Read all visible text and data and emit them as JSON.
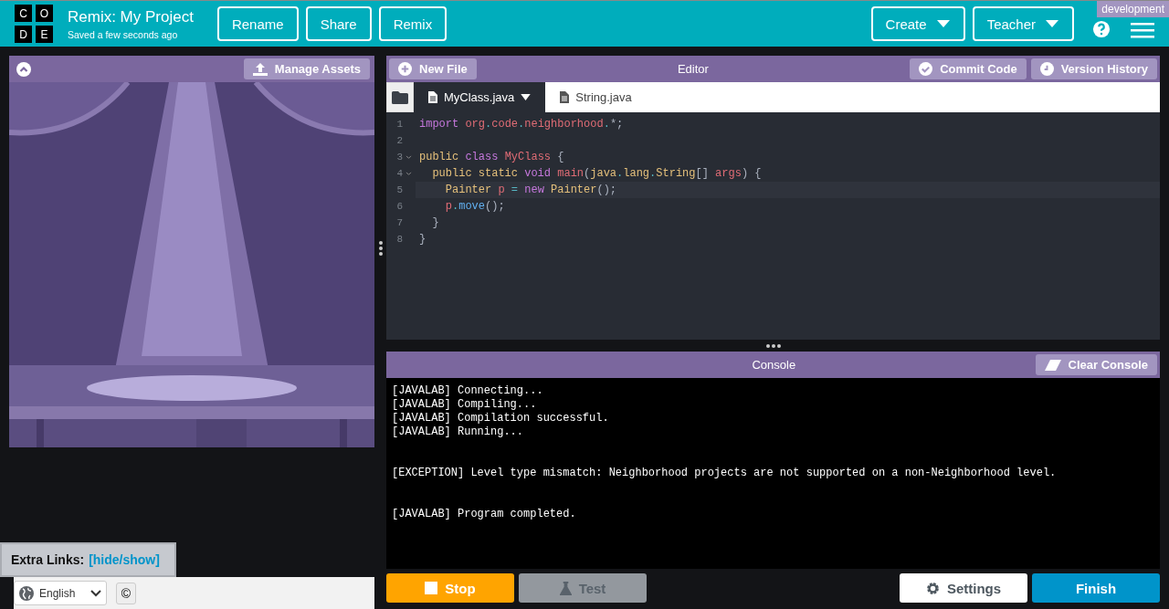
{
  "header": {
    "logo_letters": [
      "C",
      "O",
      "D",
      "E"
    ],
    "title": "Remix: My Project",
    "subtitle": "Saved a few seconds ago",
    "buttons": [
      "Rename",
      "Share",
      "Remix"
    ],
    "menus": [
      "Create",
      "Teacher"
    ],
    "badge": "development"
  },
  "preview": {
    "manage_assets": "Manage Assets"
  },
  "extra_links": {
    "label": "Extra Links:",
    "link": "[hide/show]"
  },
  "footer": {
    "language": "English",
    "copyright": "©"
  },
  "editor": {
    "title": "Editor",
    "new_file": "New File",
    "commit": "Commit Code",
    "history": "Version History",
    "tabs": [
      {
        "label": "MyClass.java",
        "selected": true
      },
      {
        "label": "String.java",
        "selected": false
      }
    ],
    "lines": [
      {
        "number": "1",
        "foldable": false,
        "active": false,
        "tokens": [
          {
            "text": "import ",
            "kind": "keyword"
          },
          {
            "text": "org",
            "kind": "name"
          },
          {
            "text": ".",
            "kind": "op"
          },
          {
            "text": "code",
            "kind": "name"
          },
          {
            "text": ".",
            "kind": "op"
          },
          {
            "text": "neighborhood",
            "kind": "name"
          },
          {
            "text": ".",
            "kind": "op"
          },
          {
            "text": "*;",
            "kind": "punct"
          }
        ]
      },
      {
        "number": "2",
        "foldable": false,
        "active": false
      },
      {
        "number": "3",
        "foldable": true,
        "active": false,
        "tokens": [
          {
            "text": "public ",
            "kind": "type"
          },
          {
            "text": "class ",
            "kind": "keyword"
          },
          {
            "text": "MyClass ",
            "kind": "name"
          },
          {
            "text": "{",
            "kind": "punct"
          }
        ]
      },
      {
        "number": "4",
        "foldable": true,
        "active": false,
        "tokens": [
          {
            "text": "  public static ",
            "kind": "type"
          },
          {
            "text": "void ",
            "kind": "keyword"
          },
          {
            "text": "main",
            "kind": "name"
          },
          {
            "text": "(",
            "kind": "punct"
          },
          {
            "text": "java",
            "kind": "type"
          },
          {
            "text": ".",
            "kind": "op"
          },
          {
            "text": "lang",
            "kind": "type"
          },
          {
            "text": ".",
            "kind": "op"
          },
          {
            "text": "String",
            "kind": "type"
          },
          {
            "text": "[] ",
            "kind": "punct"
          },
          {
            "text": "args",
            "kind": "name"
          },
          {
            "text": ") {",
            "kind": "punct"
          }
        ]
      },
      {
        "number": "5",
        "foldable": false,
        "active": true,
        "tokens": [
          {
            "text": "    Painter ",
            "kind": "type"
          },
          {
            "text": "p ",
            "kind": "name"
          },
          {
            "text": "= ",
            "kind": "op"
          },
          {
            "text": "new ",
            "kind": "keyword"
          },
          {
            "text": "Painter",
            "kind": "type"
          },
          {
            "text": "();",
            "kind": "punct"
          }
        ]
      },
      {
        "number": "6",
        "foldable": false,
        "active": false,
        "tokens": [
          {
            "text": "    p",
            "kind": "name"
          },
          {
            "text": ".",
            "kind": "op"
          },
          {
            "text": "move",
            "kind": "method"
          },
          {
            "text": "();",
            "kind": "punct"
          }
        ]
      },
      {
        "number": "7",
        "foldable": false,
        "active": false,
        "tokens": [
          {
            "text": "  }",
            "kind": "punct"
          }
        ]
      },
      {
        "number": "8",
        "foldable": false,
        "active": false,
        "tokens": [
          {
            "text": "}",
            "kind": "punct"
          }
        ]
      }
    ]
  },
  "console": {
    "title": "Console",
    "clear": "Clear Console",
    "blocks": [
      [
        "[JAVALAB] Connecting...",
        "[JAVALAB] Compiling...",
        "[JAVALAB] Compilation successful.",
        "[JAVALAB] Running..."
      ],
      [
        "[EXCEPTION] Level type mismatch: Neighborhood projects are not supported on a non-Neighborhood level."
      ],
      [
        "[JAVALAB] Program completed."
      ]
    ]
  },
  "actions": [
    {
      "label": "Stop",
      "kind": "stop",
      "disabled": false
    },
    {
      "label": "Test",
      "kind": "test",
      "disabled": true
    },
    {
      "label": "Settings",
      "kind": "settings",
      "disabled": false
    },
    {
      "label": "Finish",
      "kind": "finish",
      "disabled": false
    }
  ]
}
